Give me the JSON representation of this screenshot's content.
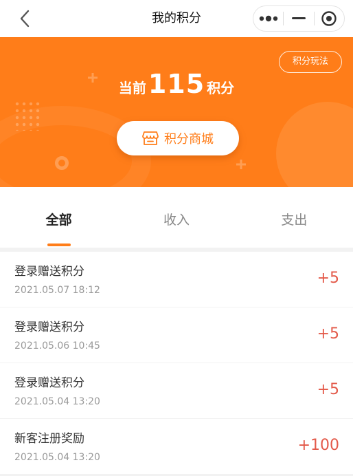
{
  "navbar": {
    "title": "我的积分"
  },
  "banner": {
    "rules_label": "积分玩法",
    "points_prefix": "当前",
    "points_value": "115",
    "points_suffix": "积分",
    "mall_label": "积分商城"
  },
  "tabs": [
    {
      "label": "全部",
      "active": true
    },
    {
      "label": "收入",
      "active": false
    },
    {
      "label": "支出",
      "active": false
    }
  ],
  "records": [
    {
      "title": "登录赠送积分",
      "time": "2021.05.07 18:12",
      "amount": "+5"
    },
    {
      "title": "登录赠送积分",
      "time": "2021.05.06 10:45",
      "amount": "+5"
    },
    {
      "title": "登录赠送积分",
      "time": "2021.05.04 13:20",
      "amount": "+5"
    },
    {
      "title": "新客注册奖励",
      "time": "2021.05.04 13:20",
      "amount": "+100"
    }
  ],
  "colors": {
    "accent": "#ff7d19",
    "amount": "#e35a4a",
    "background": "#f2f2f2"
  },
  "icons": {
    "back": "chevron-left-icon",
    "more": "more-dots-icon",
    "minimize": "minus-icon",
    "close": "target-circle-icon",
    "mall": "shop-icon"
  }
}
